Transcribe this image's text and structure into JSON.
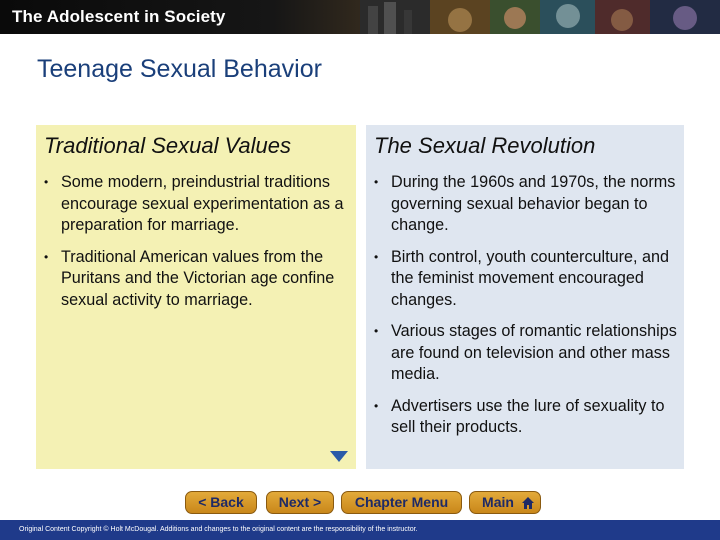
{
  "banner": {
    "title": "The Adolescent in Society"
  },
  "slide": {
    "title": "Teenage Sexual Behavior"
  },
  "left_panel": {
    "heading": "Traditional Sexual Values",
    "bullets": [
      "Some modern, preindustrial traditions encourage sexual experimentation as a preparation for marriage.",
      "Traditional American values from the Puritans and the Victorian age confine sexual activity to marriage."
    ]
  },
  "right_panel": {
    "heading": "The Sexual Revolution",
    "bullets": [
      "During the 1960s and 1970s, the norms governing sexual behavior began to change.",
      "Birth control, youth counterculture, and the feminist movement encouraged changes.",
      "Various stages of romantic relationships are found on television and other mass media.",
      "Advertisers use the lure of sexuality to sell their products."
    ]
  },
  "nav": {
    "back_label": "< Back",
    "next_label": "Next >",
    "chapter_label": "Chapter Menu",
    "main_label": "Main"
  },
  "footer": {
    "text": "Original Content Copyright © Holt McDougal. Additions and changes to the original content are the responsibility of the instructor."
  },
  "colors": {
    "title_blue": "#1a3f7a",
    "left_panel_bg": "#f4f1b4",
    "right_panel_bg": "#dfe6f0",
    "nav_button": "#d9982a",
    "footer_bg": "#1f3a8a"
  },
  "icons": {
    "bullet": "bullet-dot-icon",
    "arrow": "down-triangle-icon",
    "main": "house-icon"
  }
}
